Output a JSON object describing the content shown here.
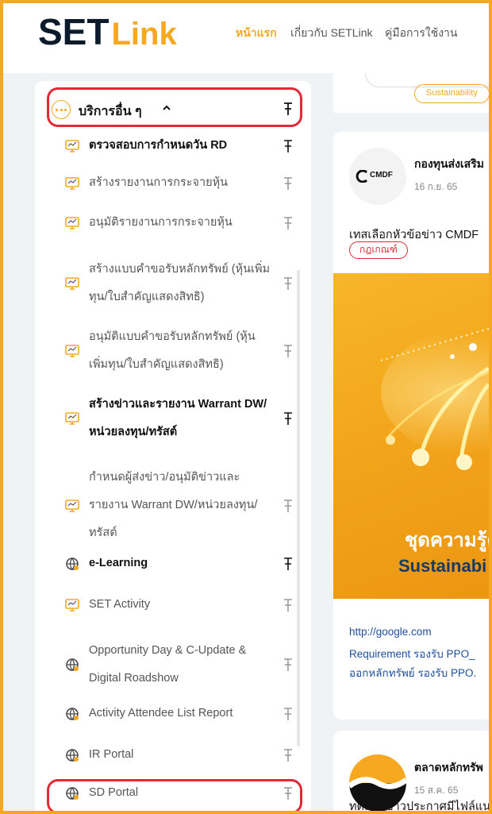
{
  "header": {
    "logo_main": "SET",
    "logo_accent": "Link",
    "nav": [
      "หน้าแรก",
      "เกี่ยวกับ SETLink",
      "คู่มือการใช้งาน"
    ]
  },
  "sidebar": {
    "group_label": "บริการอื่น ๆ",
    "items": [
      {
        "lines": [
          "ตรวจสอบการกำหนดวัน RD"
        ],
        "bold": true,
        "icon": "monitor-icon"
      },
      {
        "lines": [
          "สร้างรายงานการกระจายหุ้น"
        ],
        "bold": false,
        "icon": "monitor-icon"
      },
      {
        "lines": [
          "อนุมัติรายงานการกระจายหุ้น"
        ],
        "bold": false,
        "icon": "monitor-icon"
      },
      {
        "lines": [
          "สร้างแบบคำขอรับหลักทรัพย์ (หุ้นเพิ่ม",
          "ทุน/ใบสำคัญแสดงสิทธิ)"
        ],
        "bold": false,
        "icon": "monitor-icon"
      },
      {
        "lines": [
          "อนุมัติแบบคำขอรับหลักทรัพย์ (หุ้น",
          "เพิ่มทุน/ใบสำคัญแสดงสิทธิ)"
        ],
        "bold": false,
        "icon": "monitor-icon"
      },
      {
        "lines": [
          "สร้างข่าวและรายงาน Warrant DW/",
          "หน่วยลงทุน/ทรัสต์"
        ],
        "bold": true,
        "icon": "monitor-icon"
      },
      {
        "lines": [
          "กำหนดผู้ส่งข่าว/อนุมัติข่าวและ",
          "รายงาน Warrant DW/หน่วยลงทุน/",
          "ทรัสต์"
        ],
        "bold": false,
        "icon": "monitor-icon"
      },
      {
        "lines": [
          "e-Learning"
        ],
        "bold": true,
        "icon": "globe-icon"
      },
      {
        "lines": [
          "SET Activity"
        ],
        "bold": false,
        "icon": "monitor-icon"
      },
      {
        "lines": [
          "Opportunity Day & C-Update &",
          "Digital Roadshow"
        ],
        "bold": false,
        "icon": "globe-icon"
      },
      {
        "lines": [
          "Activity Attendee List Report"
        ],
        "bold": false,
        "icon": "globe-icon"
      },
      {
        "lines": [
          "IR Portal"
        ],
        "bold": false,
        "icon": "globe-icon"
      },
      {
        "lines": [
          "SD Portal"
        ],
        "bold": false,
        "icon": "globe-icon"
      }
    ]
  },
  "feed": {
    "filter_chip": "Sustainability",
    "post1": {
      "logo_text": "CMDF",
      "author": "กองทุนส่งเสริม",
      "date": "16 ก.ย. 65",
      "headline": "เทสเลือกหัวข้อข่าว CMDF",
      "tag": "กฎเกณฑ์",
      "poster_line1": "ชุดความรู้ด",
      "poster_line2": "Sustainabi",
      "link1": "http://google.com",
      "link2": "Requirement รองรับ PPO_",
      "link3": "ออกหลักทรัพย์ รองรับ PPO."
    },
    "post2": {
      "author": "ตลาดหลักทรัพ",
      "date": "15 ส.ค. 65",
      "headline": "ทดสอบข่าวประกาศมีไฟล์แนบ"
    }
  },
  "colors": {
    "accent": "#f6a821",
    "highlight": "#e02b37",
    "link": "#1d4f9c",
    "dark": "#0c1a2b"
  }
}
